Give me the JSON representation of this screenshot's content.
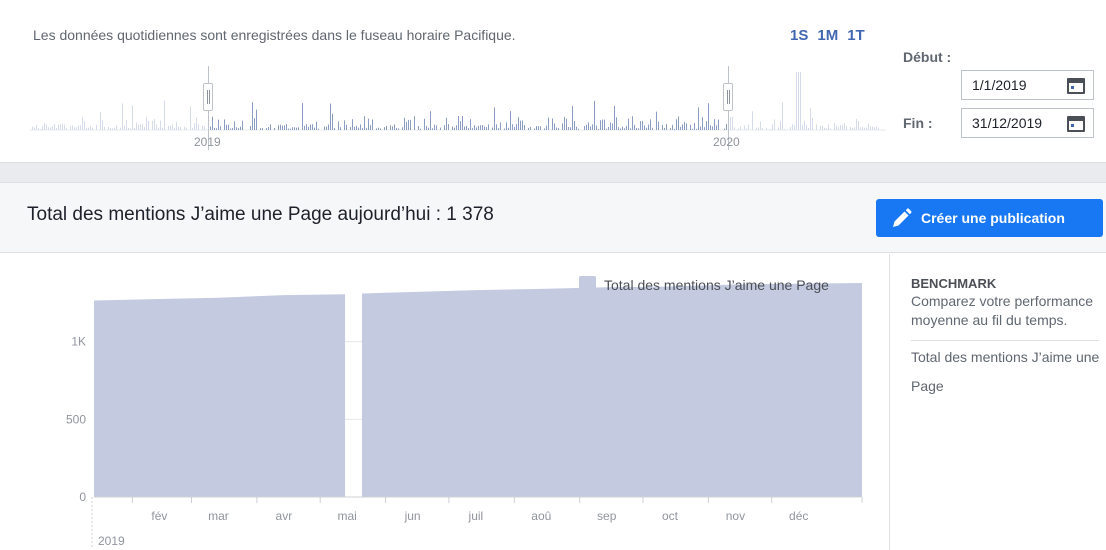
{
  "timeline": {
    "timezone_note": "Les données quotidiennes sont enregistrées dans le fuseau horaire Pacifique.",
    "ranges": [
      "1S",
      "1M",
      "1T"
    ],
    "years": [
      "2019",
      "2020"
    ]
  },
  "dates": {
    "start_label": "Début :",
    "start_value": "1/1/2019",
    "end_label": "Fin :",
    "end_value": "31/12/2019"
  },
  "header": {
    "title": "Total des mentions J’aime une Page aujourd’hui : 1 378",
    "create_button": "Créer une publication"
  },
  "benchmark": {
    "title": "BENCHMARK",
    "description": "Comparez votre performance moyenne au fil du temps.",
    "metric": "Total des mentions J’aime une Page"
  },
  "colors": {
    "accent": "#1877f2",
    "link": "#4267b2",
    "area_fill": "#c4cbe0"
  },
  "chart_data": {
    "type": "area",
    "series": [
      {
        "name": "Total des mentions J’aime une Page",
        "points": [
          [
            "2019-01-01",
            1265
          ],
          [
            "2019-02-01",
            1275
          ],
          [
            "2019-03-01",
            1283
          ],
          [
            "2019-04-01",
            1300
          ],
          [
            "2019-04-30",
            1305
          ],
          [
            "2019-05-08",
            1310
          ],
          [
            "2019-06-01",
            1320
          ],
          [
            "2019-07-01",
            1332
          ],
          [
            "2019-08-01",
            1340
          ],
          [
            "2019-09-01",
            1350
          ],
          [
            "2019-10-01",
            1355
          ],
          [
            "2019-11-01",
            1368
          ],
          [
            "2019-12-01",
            1373
          ],
          [
            "2019-12-31",
            1378
          ]
        ],
        "gap": [
          "2019-05-01",
          "2019-05-07"
        ]
      }
    ],
    "x_ticks": [
      "fév",
      "mar",
      "avr",
      "mai",
      "jun",
      "juil",
      "aoû",
      "sep",
      "oct",
      "nov",
      "déc"
    ],
    "x_year_label": "2019",
    "y_ticks": [
      "0",
      "500",
      "1K"
    ],
    "ylim": [
      0,
      1500
    ],
    "xlim": [
      "2019-01-01",
      "2019-12-31"
    ],
    "legend": "top-right",
    "grid": true
  }
}
